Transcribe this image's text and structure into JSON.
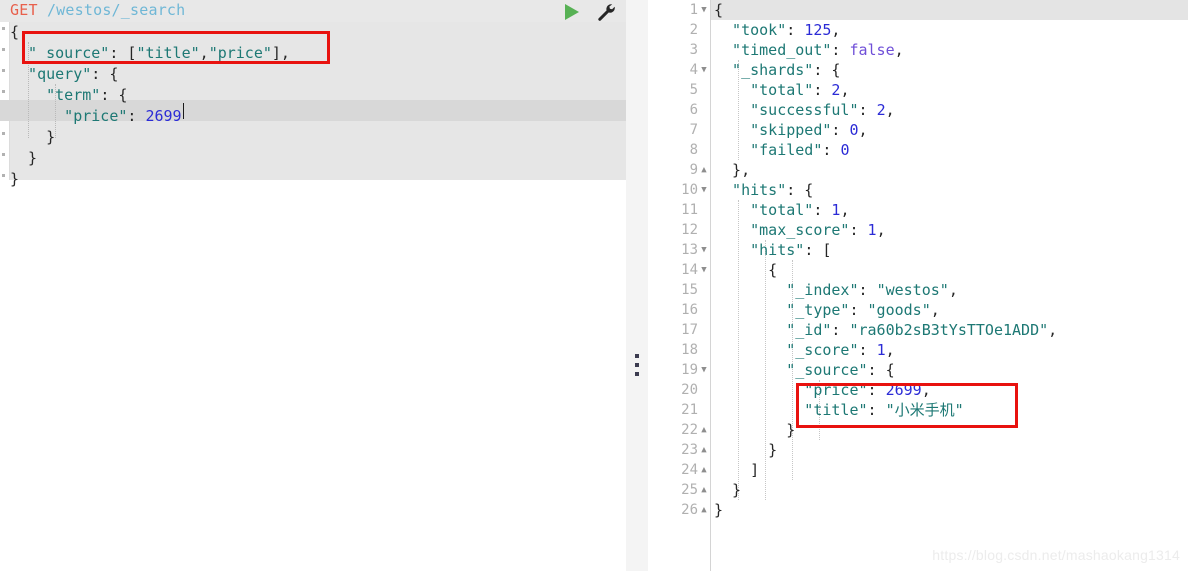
{
  "request": {
    "method": "GET",
    "path": "/westos/_search",
    "run_icon": "play-icon",
    "wrench_icon": "wrench-icon",
    "lines": [
      "{",
      "  \"_source\": [\"title\",\"price\"],",
      "  \"query\": {",
      "    \"term\": {",
      "      \"price\": 2699",
      "    }",
      "  }",
      "}"
    ],
    "line_tokens": [
      [
        {
          "t": "{",
          "c": "j-brace"
        }
      ],
      [
        {
          "t": "  \"_source\"",
          "c": "j-key"
        },
        {
          "t": ": [",
          "c": "j-punct"
        },
        {
          "t": "\"title\"",
          "c": "j-str"
        },
        {
          "t": ",",
          "c": "j-punct"
        },
        {
          "t": "\"price\"",
          "c": "j-str"
        },
        {
          "t": "],",
          "c": "j-punct"
        }
      ],
      [
        {
          "t": "  \"query\"",
          "c": "j-key"
        },
        {
          "t": ": {",
          "c": "j-punct"
        }
      ],
      [
        {
          "t": "    \"term\"",
          "c": "j-key"
        },
        {
          "t": ": {",
          "c": "j-punct"
        }
      ],
      [
        {
          "t": "      \"price\"",
          "c": "j-key"
        },
        {
          "t": ": ",
          "c": "j-punct"
        },
        {
          "t": "2699",
          "c": "j-num"
        }
      ],
      [
        {
          "t": "    }",
          "c": "j-brace"
        }
      ],
      [
        {
          "t": "  }",
          "c": "j-brace"
        }
      ],
      [
        {
          "t": "}",
          "c": "j-brace"
        }
      ]
    ],
    "active_line_index": 4,
    "highlight_note": "source-filter-highlight"
  },
  "response": {
    "line_numbers": [
      "1",
      "2",
      "3",
      "4",
      "5",
      "6",
      "7",
      "8",
      "9",
      "10",
      "11",
      "12",
      "13",
      "14",
      "15",
      "16",
      "17",
      "18",
      "19",
      "20",
      "21",
      "22",
      "23",
      "24",
      "25",
      "26"
    ],
    "fold_markers": {
      "1": "down",
      "4": "down",
      "9": "up",
      "10": "down",
      "13": "down",
      "14": "down",
      "19": "down",
      "22": "up",
      "23": "up",
      "24": "up",
      "25": "up",
      "26": "up"
    },
    "active_line_number": "1",
    "line_tokens": [
      [
        {
          "t": "{",
          "c": "j-brace"
        }
      ],
      [
        {
          "t": "  \"took\"",
          "c": "j-key"
        },
        {
          "t": ": ",
          "c": "j-punct"
        },
        {
          "t": "125",
          "c": "j-num"
        },
        {
          "t": ",",
          "c": "j-punct"
        }
      ],
      [
        {
          "t": "  \"timed_out\"",
          "c": "j-key"
        },
        {
          "t": ": ",
          "c": "j-punct"
        },
        {
          "t": "false",
          "c": "j-bool"
        },
        {
          "t": ",",
          "c": "j-punct"
        }
      ],
      [
        {
          "t": "  \"_shards\"",
          "c": "j-key"
        },
        {
          "t": ": {",
          "c": "j-punct"
        }
      ],
      [
        {
          "t": "    \"total\"",
          "c": "j-key"
        },
        {
          "t": ": ",
          "c": "j-punct"
        },
        {
          "t": "2",
          "c": "j-num"
        },
        {
          "t": ",",
          "c": "j-punct"
        }
      ],
      [
        {
          "t": "    \"successful\"",
          "c": "j-key"
        },
        {
          "t": ": ",
          "c": "j-punct"
        },
        {
          "t": "2",
          "c": "j-num"
        },
        {
          "t": ",",
          "c": "j-punct"
        }
      ],
      [
        {
          "t": "    \"skipped\"",
          "c": "j-key"
        },
        {
          "t": ": ",
          "c": "j-punct"
        },
        {
          "t": "0",
          "c": "j-num"
        },
        {
          "t": ",",
          "c": "j-punct"
        }
      ],
      [
        {
          "t": "    \"failed\"",
          "c": "j-key"
        },
        {
          "t": ": ",
          "c": "j-punct"
        },
        {
          "t": "0",
          "c": "j-num"
        }
      ],
      [
        {
          "t": "  },",
          "c": "j-brace"
        }
      ],
      [
        {
          "t": "  \"hits\"",
          "c": "j-key"
        },
        {
          "t": ": {",
          "c": "j-punct"
        }
      ],
      [
        {
          "t": "    \"total\"",
          "c": "j-key"
        },
        {
          "t": ": ",
          "c": "j-punct"
        },
        {
          "t": "1",
          "c": "j-num"
        },
        {
          "t": ",",
          "c": "j-punct"
        }
      ],
      [
        {
          "t": "    \"max_score\"",
          "c": "j-key"
        },
        {
          "t": ": ",
          "c": "j-punct"
        },
        {
          "t": "1",
          "c": "j-num"
        },
        {
          "t": ",",
          "c": "j-punct"
        }
      ],
      [
        {
          "t": "    \"hits\"",
          "c": "j-key"
        },
        {
          "t": ": [",
          "c": "j-punct"
        }
      ],
      [
        {
          "t": "      {",
          "c": "j-brace"
        }
      ],
      [
        {
          "t": "        \"_index\"",
          "c": "j-key"
        },
        {
          "t": ": ",
          "c": "j-punct"
        },
        {
          "t": "\"westos\"",
          "c": "j-str"
        },
        {
          "t": ",",
          "c": "j-punct"
        }
      ],
      [
        {
          "t": "        \"_type\"",
          "c": "j-key"
        },
        {
          "t": ": ",
          "c": "j-punct"
        },
        {
          "t": "\"goods\"",
          "c": "j-str"
        },
        {
          "t": ",",
          "c": "j-punct"
        }
      ],
      [
        {
          "t": "        \"_id\"",
          "c": "j-key"
        },
        {
          "t": ": ",
          "c": "j-punct"
        },
        {
          "t": "\"ra60b2sB3tYsTTOe1ADD\"",
          "c": "j-str"
        },
        {
          "t": ",",
          "c": "j-punct"
        }
      ],
      [
        {
          "t": "        \"_score\"",
          "c": "j-key"
        },
        {
          "t": ": ",
          "c": "j-punct"
        },
        {
          "t": "1",
          "c": "j-num"
        },
        {
          "t": ",",
          "c": "j-punct"
        }
      ],
      [
        {
          "t": "        \"_source\"",
          "c": "j-key"
        },
        {
          "t": ": {",
          "c": "j-punct"
        }
      ],
      [
        {
          "t": "          \"price\"",
          "c": "j-key"
        },
        {
          "t": ": ",
          "c": "j-punct"
        },
        {
          "t": "2699",
          "c": "j-num"
        },
        {
          "t": ",",
          "c": "j-punct"
        }
      ],
      [
        {
          "t": "          \"title\"",
          "c": "j-key"
        },
        {
          "t": ": ",
          "c": "j-punct"
        },
        {
          "t": "\"小米手机\"",
          "c": "j-str"
        }
      ],
      [
        {
          "t": "        }",
          "c": "j-brace"
        }
      ],
      [
        {
          "t": "      }",
          "c": "j-brace"
        }
      ],
      [
        {
          "t": "    ]",
          "c": "j-brace"
        }
      ],
      [
        {
          "t": "  }",
          "c": "j-brace"
        }
      ],
      [
        {
          "t": "}",
          "c": "j-brace"
        }
      ]
    ],
    "values": {
      "took": 125,
      "timed_out": false,
      "shards_total": 2,
      "shards_successful": 2,
      "shards_skipped": 0,
      "shards_failed": 0,
      "hits_total": 1,
      "max_score": 1,
      "hit_index": "westos",
      "hit_type": "goods",
      "hit_id": "ra60b2sB3tYsTTOe1ADD",
      "hit_score": 1,
      "source_price": 2699,
      "source_title": "小米手机"
    },
    "highlight_note": "source-fields-highlight"
  },
  "splitter": {
    "handle_icon": "drag-handle-dots-icon"
  },
  "watermark": {
    "text": "https://blog.csdn.net/mashaokang1314"
  },
  "colors": {
    "annotation_red": "#e8120f",
    "run_green": "#57b154",
    "method_red": "#e8604c",
    "path_blue": "#6fb7d6",
    "json_key_teal": "#1d7874",
    "json_number_blue": "#2b2bd6",
    "json_bool_purple": "#6f4fd8"
  }
}
